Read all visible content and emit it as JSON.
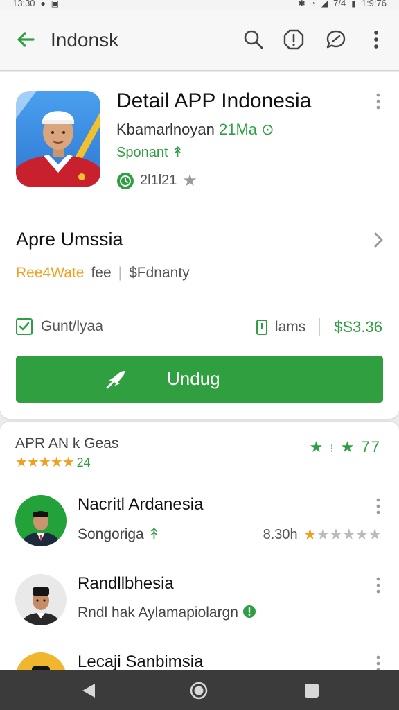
{
  "status": {
    "time": "13:30",
    "right_text": "1:9:76",
    "network_label": "7/4"
  },
  "appbar": {
    "title": "Indonsk"
  },
  "app": {
    "title": "Detail APP Indonesia",
    "developer": "Kbamarlnoyan",
    "developer_tag": "21Ma",
    "sponsor": "Sponant",
    "meta_text": "2l1l21"
  },
  "section": {
    "title": "Apre Umssia",
    "tag1": "Ree4Wate",
    "tag2": "fee",
    "tag3": "$Fdnanty"
  },
  "check": {
    "label": "Gunt/lyaa",
    "info": "lams",
    "price": "$S3.36"
  },
  "install": {
    "label": "Undug"
  },
  "reviews": {
    "title": "APR AN k Geas",
    "stars_count": "24",
    "right_value": "77",
    "items": [
      {
        "name": "Nacritl Ardanesia",
        "subtitle": "Songoriga",
        "meta": "8.30h"
      },
      {
        "name": "Randllbhesia",
        "subtitle": "Rndl hak Aylamapiolargn"
      },
      {
        "name": "Lecaji Sanbimsia"
      }
    ]
  },
  "colors": {
    "accent": "#2f9f3f",
    "star": "#f0a020",
    "navbar": "#3b3b3b"
  }
}
